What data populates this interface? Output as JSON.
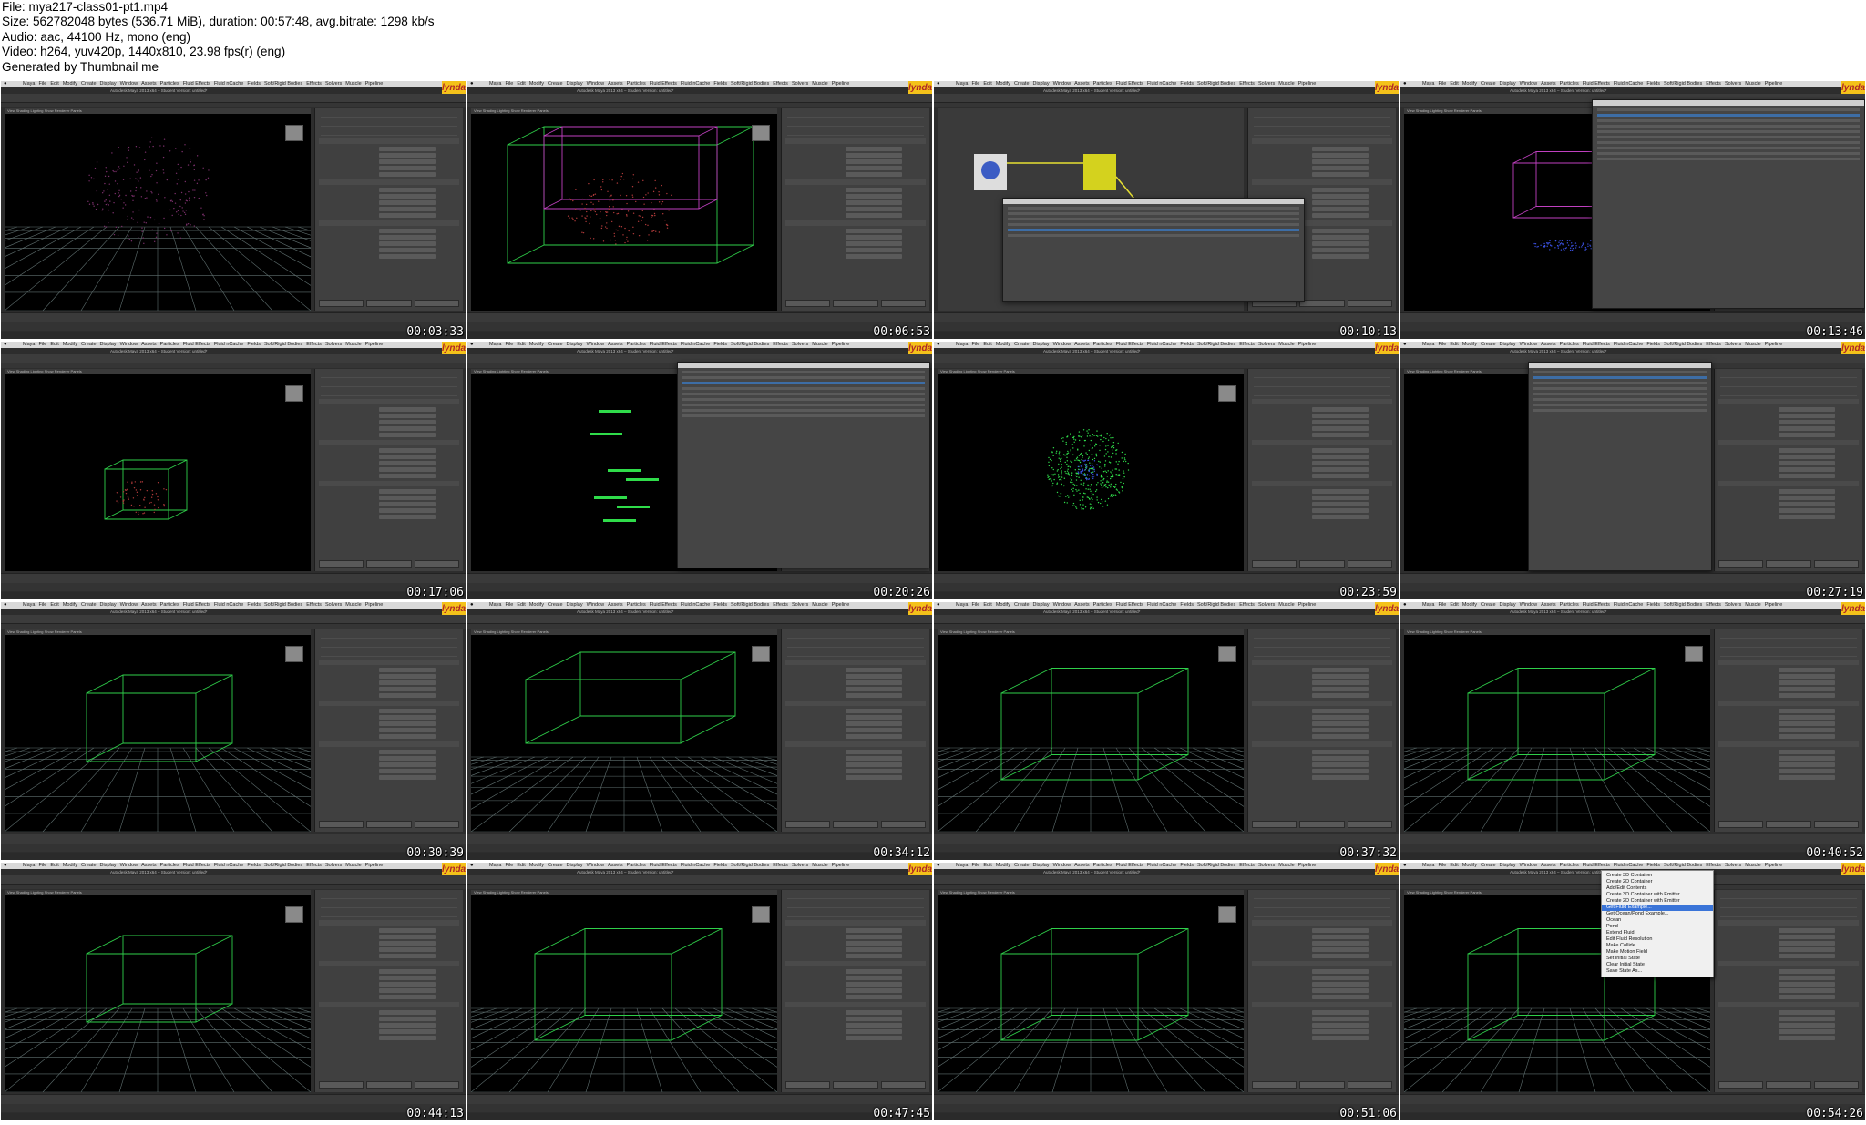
{
  "header": {
    "file_line": "File: mya217-class01-pt1.mp4",
    "size_line": "Size: 562782048 bytes (536.71 MiB), duration: 00:57:48, avg.bitrate: 1298 kb/s",
    "audio_line": "Audio: aac, 44100 Hz, mono (eng)",
    "video_line": "Video: h264, yuv420p, 1440x810, 23.98 fps(r) (eng)",
    "generated_line": "Generated by Thumbnail me"
  },
  "app": {
    "menu_items": [
      "Maya",
      "File",
      "Edit",
      "Modify",
      "Create",
      "Display",
      "Window",
      "Assets",
      "Particles",
      "Fluid Effects",
      "Fluid nCache",
      "Fields",
      "Soft/Rigid Bodies",
      "Effects",
      "Solvers",
      "Muscle",
      "Pipeline"
    ],
    "window_title": "Autodesk Maya 2013 x64 – Student Version: untitled*",
    "view_menu": "View  Shading  Lighting  Show  Renderer  Panels",
    "brand": "lynda"
  },
  "colors": {
    "accent_wire": "#34c759",
    "grid": "#5f6f6f",
    "box_green": "#2fcf4a",
    "box_pink": "#c040c0"
  },
  "thumbnails": [
    {
      "timestamp": "00:03:33",
      "scene": "particles-grid"
    },
    {
      "timestamp": "00:06:53",
      "scene": "particles-box-pink"
    },
    {
      "timestamp": "00:10:13",
      "scene": "hypershade-script"
    },
    {
      "timestamp": "00:13:46",
      "scene": "expression-editor"
    },
    {
      "timestamp": "00:17:06",
      "scene": "small-green-box"
    },
    {
      "timestamp": "00:20:26",
      "scene": "expression-numbers"
    },
    {
      "timestamp": "00:23:59",
      "scene": "particle-sphere"
    },
    {
      "timestamp": "00:27:19",
      "scene": "add-attribute"
    },
    {
      "timestamp": "00:30:39",
      "scene": "fluid-box-grid"
    },
    {
      "timestamp": "00:34:12",
      "scene": "fluid-box-flat"
    },
    {
      "timestamp": "00:37:32",
      "scene": "fluid-box-perspective"
    },
    {
      "timestamp": "00:40:52",
      "scene": "fluid-box-perspective"
    },
    {
      "timestamp": "00:44:13",
      "scene": "fluid-box-grid"
    },
    {
      "timestamp": "00:47:45",
      "scene": "fluid-box-perspective"
    },
    {
      "timestamp": "00:51:06",
      "scene": "fluid-box-perspective"
    },
    {
      "timestamp": "00:54:26",
      "scene": "fluid-effects-menu"
    }
  ],
  "fluid_menu": {
    "items": [
      "Create 3D Container",
      "Create 2D Container",
      "Add/Edit Contents",
      "Create 3D Container with Emitter",
      "Create 2D Container with Emitter",
      "Get Fluid Example...",
      "Get Ocean/Pond Example...",
      "Ocean",
      "Pond",
      "Extend Fluid",
      "Edit Fluid Resolution",
      "Make Collide",
      "Make Motion Field",
      "Set Initial State",
      "Clear Initial State",
      "Save State As..."
    ],
    "highlighted": "Get Fluid Example..."
  }
}
